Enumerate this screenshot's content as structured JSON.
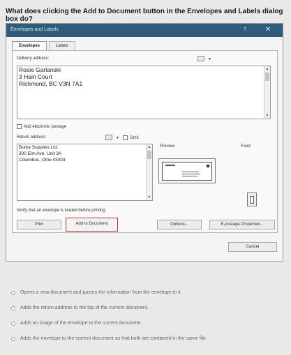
{
  "question": "What does clicking the Add to Document button in the Envelopes and Labels dialog box do?",
  "dialog": {
    "title": "Envelopes and Labels",
    "help": "?",
    "close": "✕",
    "tabs": [
      {
        "label": "Envelopes",
        "active": true
      },
      {
        "label": "Labels",
        "active": false
      }
    ],
    "delivery_label": "Delivery address:",
    "delivery_lines": [
      "Rosie Garlanski",
      "3 Hain Court",
      "Richmond, BC  V3N 7A1"
    ],
    "electronic_postage_label": "Add electronic postage",
    "return_label": "Return address:",
    "omit_label": "Omit",
    "return_lines": [
      "Burke Supplies Ltd.",
      "300 Elm Ave. Unit 3A",
      "Columbus, Ohio  43003"
    ],
    "preview_label": "Preview",
    "feed_label": "Feed",
    "verify_text": "Verify that an envelope is loaded before printing.",
    "buttons": {
      "print": "Print",
      "add_to_document": "Add to Document",
      "options": "Options...",
      "epostage": "E-postage Properties...",
      "cancel": "Cancel"
    }
  },
  "answers": [
    "Opens a new document and pastes the information from the envelope to it.",
    "Adds the return address to the top of the current document.",
    "Adds an image of the envelope to the current document.",
    "Adds the envelope to the current document so that both are contained in the same file."
  ]
}
